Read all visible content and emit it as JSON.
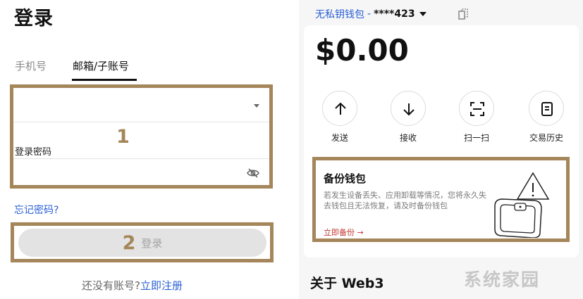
{
  "left": {
    "title": "登录",
    "tabs": [
      {
        "label": "手机号",
        "active": false
      },
      {
        "label": "邮箱/子账号",
        "active": true
      }
    ],
    "password_label": "登录密码",
    "forgot_password": "忘记密码?",
    "login_button": "登录",
    "register_prompt": "还没有账号?",
    "register_link": "立即注册",
    "annotations": [
      "1",
      "2"
    ]
  },
  "right": {
    "wallet_name": "无私钥钱包",
    "wallet_separator": "-",
    "wallet_account": "****423",
    "balance": "$0.00",
    "actions": [
      {
        "label": "发送",
        "icon": "arrow-up-icon"
      },
      {
        "label": "接收",
        "icon": "arrow-down-icon"
      },
      {
        "label": "扫一扫",
        "icon": "scan-icon"
      },
      {
        "label": "交易历史",
        "icon": "history-icon"
      }
    ],
    "backup": {
      "title": "备份钱包",
      "description": "若发生设备丢失、应用卸载等情况，您将永久失去钱包且无法恢复，请及时备份钱包",
      "link": "立即备份 →"
    },
    "about_title": "关于 Web3",
    "watermark": "系统家园"
  },
  "colors": {
    "annotation_border": "#a5865a",
    "link_blue": "#2a5fd6",
    "backup_link_red": "#c2362f",
    "button_disabled": "#e3e3e3"
  }
}
